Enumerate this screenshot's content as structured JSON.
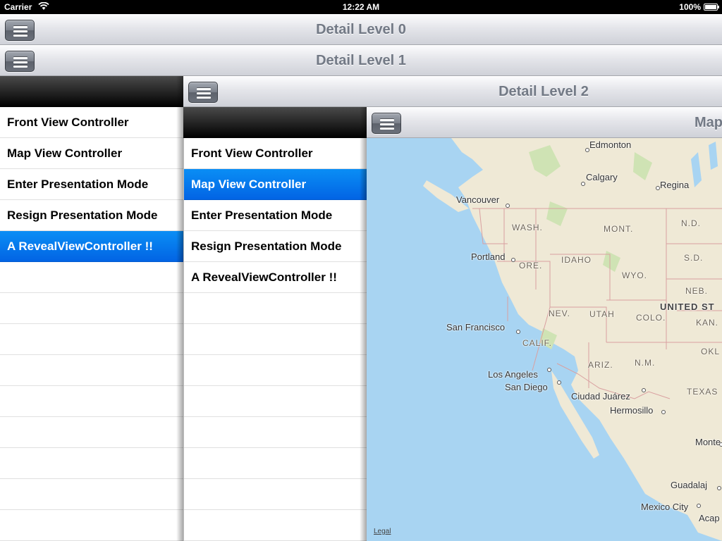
{
  "status_bar": {
    "carrier": "Carrier",
    "time": "12:22 AM",
    "battery": "100%"
  },
  "level0": {
    "title": "Detail Level 0"
  },
  "level1": {
    "title": "Detail Level 1"
  },
  "level2": {
    "title": "Detail Level 2"
  },
  "level3": {
    "title": "Map"
  },
  "rear_menu_1": {
    "items": [
      "Front View Controller",
      "Map View Controller",
      "Enter Presentation Mode",
      "Resign Presentation Mode",
      "A RevealViewController !!"
    ],
    "selected": "A RevealViewController !!"
  },
  "rear_menu_2": {
    "items": [
      "Front View Controller",
      "Map View Controller",
      "Enter Presentation Mode",
      "Resign Presentation Mode",
      "A RevealViewController !!"
    ],
    "selected": "Map View Controller"
  },
  "map": {
    "cities": [
      "Edmonton",
      "Calgary",
      "Regina",
      "Vancouver",
      "Portland",
      "San Francisco",
      "Los Angeles",
      "San Diego",
      "Ciudad Juárez",
      "Hermosillo",
      "Monte",
      "Guadalaj",
      "Mexico City",
      "Acap"
    ],
    "regions": [
      "WASH.",
      "MONT.",
      "N.D.",
      "ORE.",
      "IDAHO",
      "WYO.",
      "S.D.",
      "NEB.",
      "NEV.",
      "UTAH",
      "COLO.",
      "KAN.",
      "CALIF.",
      "ARIZ.",
      "N.M.",
      "OKL",
      "TEXAS"
    ],
    "country": "UNITED ST",
    "legal": "Legal"
  }
}
